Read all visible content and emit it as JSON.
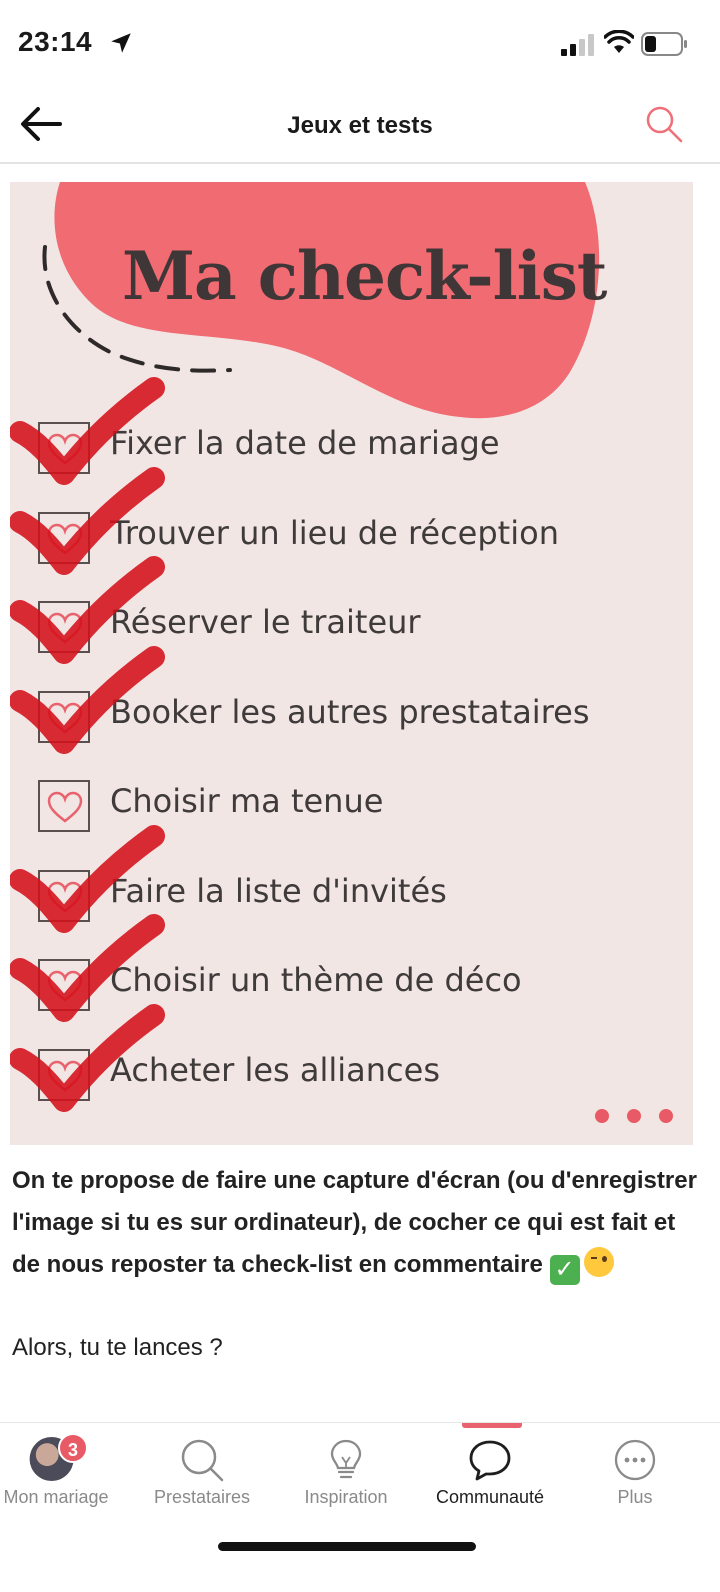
{
  "status_bar": {
    "time": "23:14",
    "icons": [
      "location-arrow-icon",
      "signal-icon",
      "wifi-icon",
      "battery-icon"
    ]
  },
  "header": {
    "title": "Jeux et tests",
    "back_icon": "arrow-left-icon",
    "search_icon": "search-icon"
  },
  "post_image": {
    "title": "Ma check-list",
    "items": [
      {
        "label": "Fixer la date de mariage",
        "checked": true
      },
      {
        "label": "Trouver un lieu de réception",
        "checked": true
      },
      {
        "label": "Réserver le traiteur",
        "checked": true
      },
      {
        "label": "Booker les autres prestataires",
        "checked": true
      },
      {
        "label": "Choisir ma tenue",
        "checked": false
      },
      {
        "label": "Faire la liste d'invités",
        "checked": true
      },
      {
        "label": "Choisir un thème de déco",
        "checked": true
      },
      {
        "label": "Acheter les alliances",
        "checked": true
      }
    ],
    "colors": {
      "background": "#f2e6e4",
      "blob": "#f06b72",
      "tick": "#d4101a"
    }
  },
  "post": {
    "body": "On te propose de faire une capture d'écran (ou d'enregistrer l'image si tu es sur ordinateur), de cocher ce qui est fait et de nous reposter ta check-list en commentaire",
    "question": "Alors, tu te lances ?"
  },
  "tab_bar": {
    "tabs": [
      {
        "label": "Mon mariage",
        "icon": "avatar",
        "badge": "3"
      },
      {
        "label": "Prestataires",
        "icon": "search-icon"
      },
      {
        "label": "Inspiration",
        "icon": "lightbulb-icon"
      },
      {
        "label": "Communauté",
        "icon": "chat-bubble-icon",
        "active": true
      },
      {
        "label": "Plus",
        "icon": "more-dots-icon"
      }
    ],
    "accent": "#e8636d"
  }
}
